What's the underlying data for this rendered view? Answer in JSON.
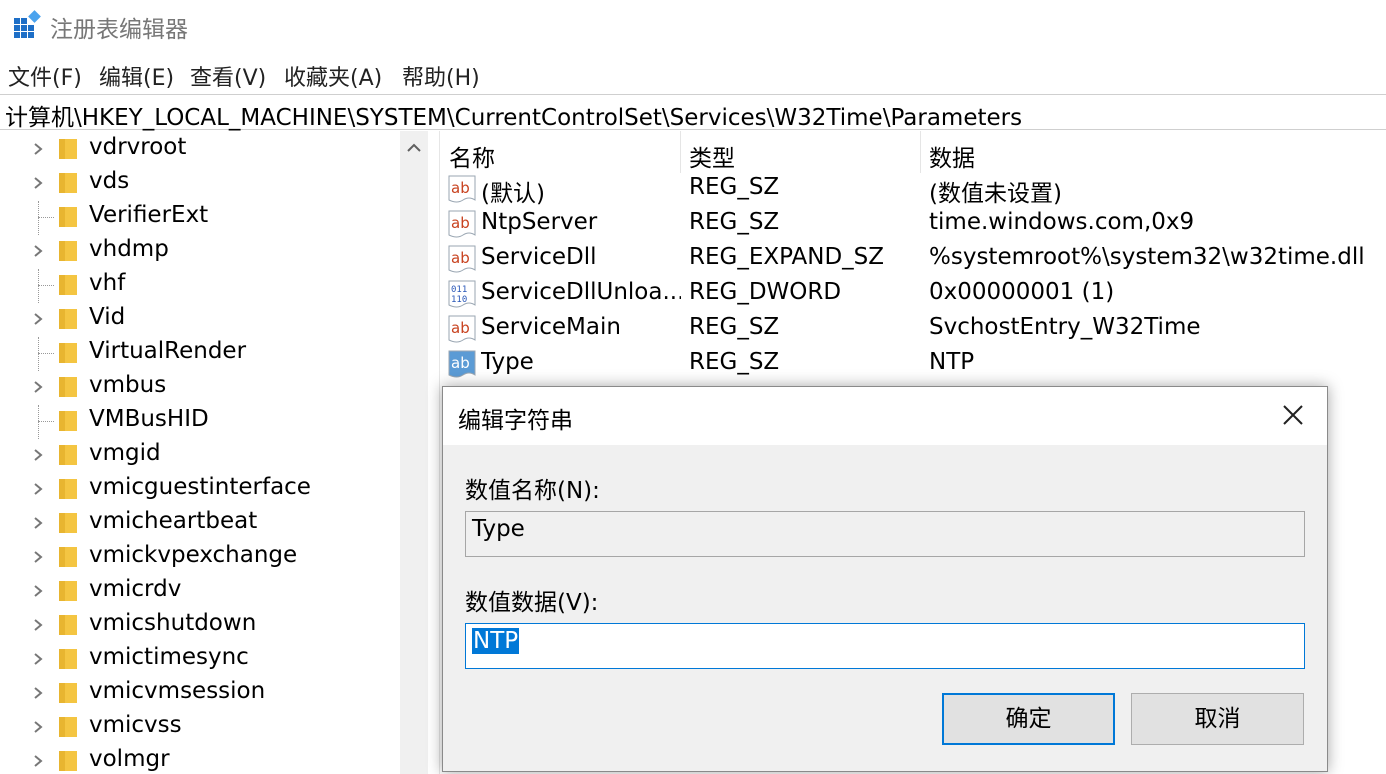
{
  "window": {
    "title": "注册表编辑器"
  },
  "menu": [
    {
      "label": "文件(F)"
    },
    {
      "label": "编辑(E)"
    },
    {
      "label": "查看(V)"
    },
    {
      "label": "收藏夹(A)"
    },
    {
      "label": "帮助(H)"
    }
  ],
  "address": {
    "path": "计算机\\HKEY_LOCAL_MACHINE\\SYSTEM\\CurrentControlSet\\Services\\W32Time\\Parameters"
  },
  "tree": {
    "items": [
      {
        "label": "vdrvroot",
        "expandable": true
      },
      {
        "label": "vds",
        "expandable": true
      },
      {
        "label": "VerifierExt",
        "expandable": false
      },
      {
        "label": "vhdmp",
        "expandable": true
      },
      {
        "label": "vhf",
        "expandable": false
      },
      {
        "label": "Vid",
        "expandable": true
      },
      {
        "label": "VirtualRender",
        "expandable": false
      },
      {
        "label": "vmbus",
        "expandable": true
      },
      {
        "label": "VMBusHID",
        "expandable": false
      },
      {
        "label": "vmgid",
        "expandable": true
      },
      {
        "label": "vmicguestinterface",
        "expandable": true
      },
      {
        "label": "vmicheartbeat",
        "expandable": true
      },
      {
        "label": "vmickvpexchange",
        "expandable": true
      },
      {
        "label": "vmicrdv",
        "expandable": true
      },
      {
        "label": "vmicshutdown",
        "expandable": true
      },
      {
        "label": "vmictimesync",
        "expandable": true
      },
      {
        "label": "vmicvmsession",
        "expandable": true
      },
      {
        "label": "vmicvss",
        "expandable": true
      },
      {
        "label": "volmgr",
        "expandable": true
      }
    ]
  },
  "list": {
    "columns": {
      "name": "名称",
      "type": "类型",
      "data": "数据"
    },
    "rows": [
      {
        "icon": "string-value-icon",
        "name": "(默认)",
        "type": "REG_SZ",
        "data": "(数值未设置)"
      },
      {
        "icon": "string-value-icon",
        "name": "NtpServer",
        "type": "REG_SZ",
        "data": "time.windows.com,0x9"
      },
      {
        "icon": "string-value-icon",
        "name": "ServiceDll",
        "type": "REG_EXPAND_SZ",
        "data": "%systemroot%\\system32\\w32time.dll"
      },
      {
        "icon": "binary-value-icon",
        "name": "ServiceDllUnloa...",
        "type": "REG_DWORD",
        "data": "0x00000001 (1)"
      },
      {
        "icon": "string-value-icon",
        "name": "ServiceMain",
        "type": "REG_SZ",
        "data": "SvchostEntry_W32Time"
      },
      {
        "icon": "string-value-icon-selected",
        "name": "Type",
        "type": "REG_SZ",
        "data": "NTP"
      }
    ]
  },
  "dialog": {
    "title": "编辑字符串",
    "name_label": "数值名称(N):",
    "name_value": "Type",
    "data_label": "数值数据(V):",
    "data_value": "NTP",
    "ok_label": "确定",
    "cancel_label": "取消"
  },
  "colors": {
    "accent": "#0078d7",
    "folder": "#f4c542",
    "dialog_bg": "#f0f0f0"
  }
}
